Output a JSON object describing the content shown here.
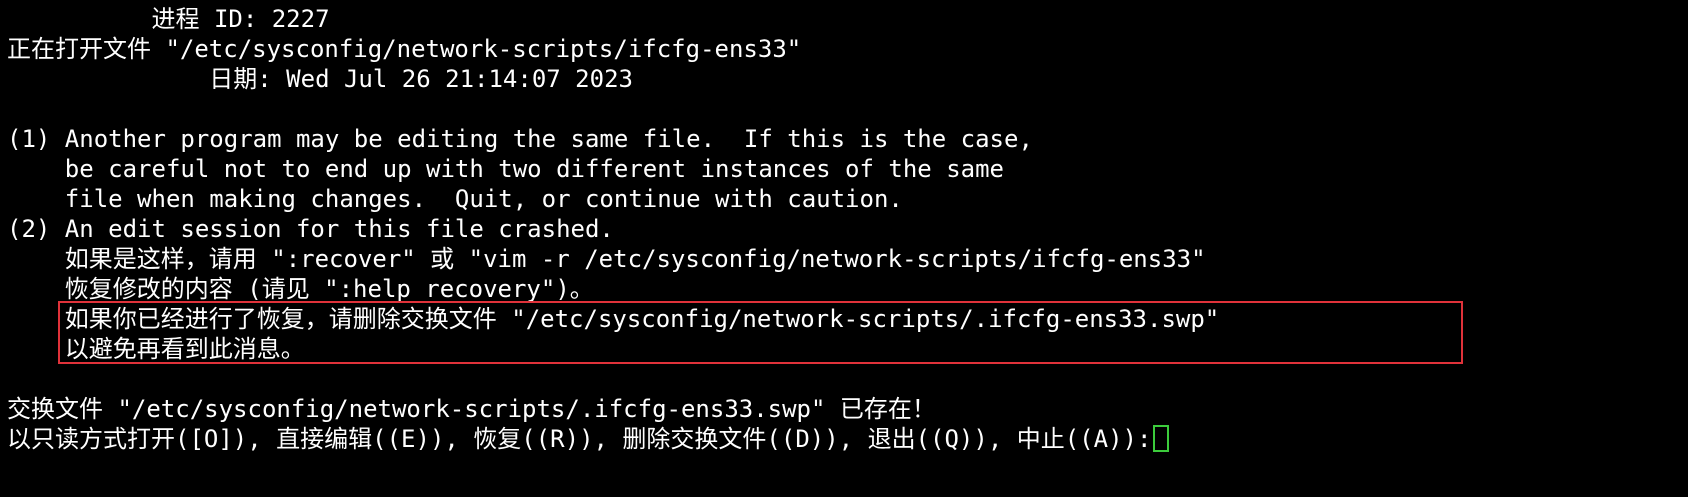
{
  "lines": {
    "process_id": "          进程 ID: 2227",
    "opening_file": "正在打开文件 \"/etc/sysconfig/network-scripts/ifcfg-ens33\"",
    "date": "              日期: Wed Jul 26 21:14:07 2023",
    "blank1": "",
    "msg1_a": "(1) Another program may be editing the same file.  If this is the case,",
    "msg1_b": "    be careful not to end up with two different instances of the same",
    "msg1_c": "    file when making changes.  Quit, or continue with caution.",
    "msg2_a": "(2) An edit session for this file crashed.",
    "msg2_b": "    如果是这样，请用 \":recover\" 或 \"vim -r /etc/sysconfig/network-scripts/ifcfg-ens33\"",
    "msg2_c": "    恢复修改的内容 (请见 \":help recovery\")。",
    "msg2_d": "    如果你已经进行了恢复，请删除交换文件 \"/etc/sysconfig/network-scripts/.ifcfg-ens33.swp\"",
    "msg2_e": "    以避免再看到此消息。",
    "blank2": "",
    "swap_exists": "交换文件 \"/etc/sysconfig/network-scripts/.ifcfg-ens33.swp\" 已存在！",
    "prompt": "以只读方式打开([O]), 直接编辑((E)), 恢复((R)), 删除交换文件((D)), 退出((Q)), 中止((A)):"
  },
  "colors": {
    "background": "#000000",
    "text": "#ffffff",
    "highlight_border": "#e0323a",
    "cursor": "#3ccc3c"
  }
}
